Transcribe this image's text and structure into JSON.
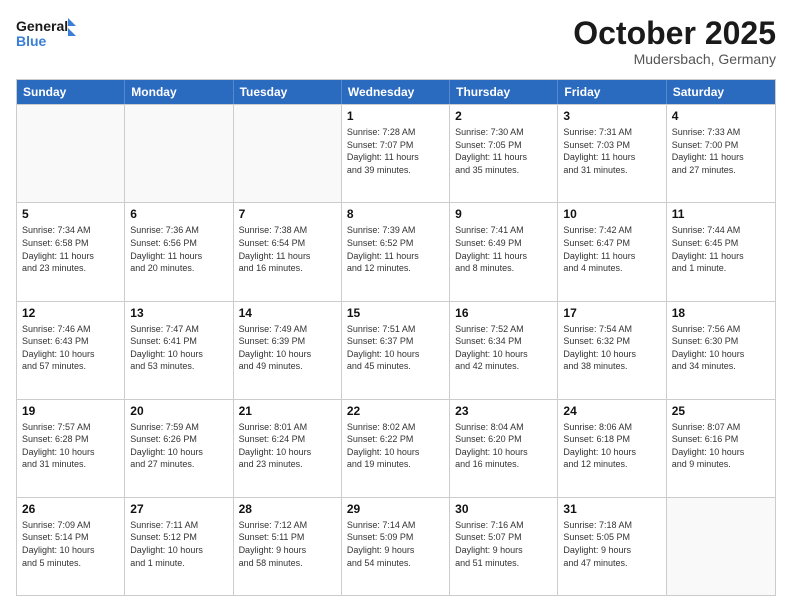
{
  "header": {
    "logo_general": "General",
    "logo_blue": "Blue",
    "month_title": "October 2025",
    "location": "Mudersbach, Germany"
  },
  "days_of_week": [
    "Sunday",
    "Monday",
    "Tuesday",
    "Wednesday",
    "Thursday",
    "Friday",
    "Saturday"
  ],
  "weeks": [
    [
      {
        "day": "",
        "info": ""
      },
      {
        "day": "",
        "info": ""
      },
      {
        "day": "",
        "info": ""
      },
      {
        "day": "1",
        "info": "Sunrise: 7:28 AM\nSunset: 7:07 PM\nDaylight: 11 hours\nand 39 minutes."
      },
      {
        "day": "2",
        "info": "Sunrise: 7:30 AM\nSunset: 7:05 PM\nDaylight: 11 hours\nand 35 minutes."
      },
      {
        "day": "3",
        "info": "Sunrise: 7:31 AM\nSunset: 7:03 PM\nDaylight: 11 hours\nand 31 minutes."
      },
      {
        "day": "4",
        "info": "Sunrise: 7:33 AM\nSunset: 7:00 PM\nDaylight: 11 hours\nand 27 minutes."
      }
    ],
    [
      {
        "day": "5",
        "info": "Sunrise: 7:34 AM\nSunset: 6:58 PM\nDaylight: 11 hours\nand 23 minutes."
      },
      {
        "day": "6",
        "info": "Sunrise: 7:36 AM\nSunset: 6:56 PM\nDaylight: 11 hours\nand 20 minutes."
      },
      {
        "day": "7",
        "info": "Sunrise: 7:38 AM\nSunset: 6:54 PM\nDaylight: 11 hours\nand 16 minutes."
      },
      {
        "day": "8",
        "info": "Sunrise: 7:39 AM\nSunset: 6:52 PM\nDaylight: 11 hours\nand 12 minutes."
      },
      {
        "day": "9",
        "info": "Sunrise: 7:41 AM\nSunset: 6:49 PM\nDaylight: 11 hours\nand 8 minutes."
      },
      {
        "day": "10",
        "info": "Sunrise: 7:42 AM\nSunset: 6:47 PM\nDaylight: 11 hours\nand 4 minutes."
      },
      {
        "day": "11",
        "info": "Sunrise: 7:44 AM\nSunset: 6:45 PM\nDaylight: 11 hours\nand 1 minute."
      }
    ],
    [
      {
        "day": "12",
        "info": "Sunrise: 7:46 AM\nSunset: 6:43 PM\nDaylight: 10 hours\nand 57 minutes."
      },
      {
        "day": "13",
        "info": "Sunrise: 7:47 AM\nSunset: 6:41 PM\nDaylight: 10 hours\nand 53 minutes."
      },
      {
        "day": "14",
        "info": "Sunrise: 7:49 AM\nSunset: 6:39 PM\nDaylight: 10 hours\nand 49 minutes."
      },
      {
        "day": "15",
        "info": "Sunrise: 7:51 AM\nSunset: 6:37 PM\nDaylight: 10 hours\nand 45 minutes."
      },
      {
        "day": "16",
        "info": "Sunrise: 7:52 AM\nSunset: 6:34 PM\nDaylight: 10 hours\nand 42 minutes."
      },
      {
        "day": "17",
        "info": "Sunrise: 7:54 AM\nSunset: 6:32 PM\nDaylight: 10 hours\nand 38 minutes."
      },
      {
        "day": "18",
        "info": "Sunrise: 7:56 AM\nSunset: 6:30 PM\nDaylight: 10 hours\nand 34 minutes."
      }
    ],
    [
      {
        "day": "19",
        "info": "Sunrise: 7:57 AM\nSunset: 6:28 PM\nDaylight: 10 hours\nand 31 minutes."
      },
      {
        "day": "20",
        "info": "Sunrise: 7:59 AM\nSunset: 6:26 PM\nDaylight: 10 hours\nand 27 minutes."
      },
      {
        "day": "21",
        "info": "Sunrise: 8:01 AM\nSunset: 6:24 PM\nDaylight: 10 hours\nand 23 minutes."
      },
      {
        "day": "22",
        "info": "Sunrise: 8:02 AM\nSunset: 6:22 PM\nDaylight: 10 hours\nand 19 minutes."
      },
      {
        "day": "23",
        "info": "Sunrise: 8:04 AM\nSunset: 6:20 PM\nDaylight: 10 hours\nand 16 minutes."
      },
      {
        "day": "24",
        "info": "Sunrise: 8:06 AM\nSunset: 6:18 PM\nDaylight: 10 hours\nand 12 minutes."
      },
      {
        "day": "25",
        "info": "Sunrise: 8:07 AM\nSunset: 6:16 PM\nDaylight: 10 hours\nand 9 minutes."
      }
    ],
    [
      {
        "day": "26",
        "info": "Sunrise: 7:09 AM\nSunset: 5:14 PM\nDaylight: 10 hours\nand 5 minutes."
      },
      {
        "day": "27",
        "info": "Sunrise: 7:11 AM\nSunset: 5:12 PM\nDaylight: 10 hours\nand 1 minute."
      },
      {
        "day": "28",
        "info": "Sunrise: 7:12 AM\nSunset: 5:11 PM\nDaylight: 9 hours\nand 58 minutes."
      },
      {
        "day": "29",
        "info": "Sunrise: 7:14 AM\nSunset: 5:09 PM\nDaylight: 9 hours\nand 54 minutes."
      },
      {
        "day": "30",
        "info": "Sunrise: 7:16 AM\nSunset: 5:07 PM\nDaylight: 9 hours\nand 51 minutes."
      },
      {
        "day": "31",
        "info": "Sunrise: 7:18 AM\nSunset: 5:05 PM\nDaylight: 9 hours\nand 47 minutes."
      },
      {
        "day": "",
        "info": ""
      }
    ]
  ]
}
